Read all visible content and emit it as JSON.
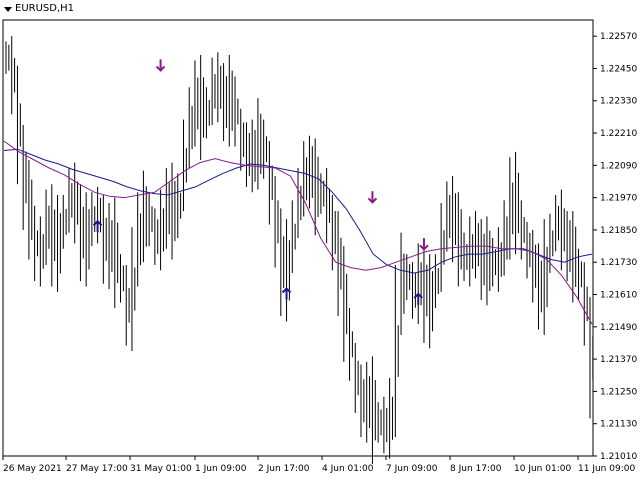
{
  "chart_data": {
    "type": "line",
    "symbol": "EURUSD,H1",
    "title": "EURUSD,H1",
    "ylim": [
      1.2101,
      1.2263
    ],
    "y_ticks": [
      "1.22570",
      "1.22450",
      "1.22330",
      "1.22210",
      "1.22090",
      "1.21970",
      "1.21850",
      "1.21730",
      "1.21610",
      "1.21490",
      "1.21370",
      "1.21250",
      "1.21130",
      "1.21010"
    ],
    "x_ticks": [
      "26 May 2021",
      "27 May 17:00",
      "31 May 01:00",
      "1 Jun 09:00",
      "2 Jun 17:00",
      "4 Jun 01:00",
      "7 Jun 09:00",
      "8 Jun 17:00",
      "10 Jun 01:00",
      "11 Jun 09:00"
    ],
    "price_series": [
      1.2249,
      1.2236,
      1.2212,
      1.2197,
      1.2188,
      1.2172,
      1.2182,
      1.219,
      1.2176,
      1.2184,
      1.2192,
      1.22,
      1.219,
      1.2178,
      1.2185,
      1.2193,
      1.2188,
      1.2175,
      1.2183,
      1.217,
      1.2164,
      1.215,
      1.2176,
      1.2187,
      1.2193,
      1.2185,
      1.218,
      1.219,
      1.2196,
      1.2188,
      1.22,
      1.2218,
      1.2228,
      1.2236,
      1.2225,
      1.2232,
      1.2241,
      1.2235,
      1.223,
      1.2236,
      1.2222,
      1.2215,
      1.2211,
      1.2214,
      1.222,
      1.221,
      1.2195,
      1.2181,
      1.2165,
      1.2175,
      1.219,
      1.22,
      1.2208,
      1.2205,
      1.2197,
      1.22,
      1.2188,
      1.218,
      1.2165,
      1.215,
      1.2135,
      1.2125,
      1.2118,
      1.2124,
      1.2112,
      1.2115,
      1.211,
      1.212,
      1.216,
      1.217,
      1.2165,
      1.216,
      1.217,
      1.2155,
      1.2162,
      1.217,
      1.2187,
      1.2193,
      1.2185,
      1.2178,
      1.2172,
      1.2182,
      1.2177,
      1.2171,
      1.2176,
      1.217,
      1.2178,
      1.2186,
      1.22,
      1.219,
      1.218,
      1.2175,
      1.2168,
      1.216,
      1.2175,
      1.2185,
      1.219,
      1.218,
      1.2178,
      1.2172,
      1.2165,
      1.215,
      1.2125
    ],
    "series": [
      {
        "name": "",
        "color": "#1a1a8c",
        "values": [
          1.22145,
          1.2215,
          1.2213,
          1.2211,
          1.22095,
          1.22075,
          1.2206,
          1.22045,
          1.2203,
          1.2201,
          1.21995,
          1.21985,
          1.2198,
          1.21995,
          1.2201,
          1.22035,
          1.2206,
          1.2208,
          1.22095,
          1.2209,
          1.2208,
          1.2207,
          1.2206,
          1.2204,
          1.2199,
          1.2193,
          1.2185,
          1.2176,
          1.2172,
          1.217,
          1.2169,
          1.217,
          1.2173,
          1.2175,
          1.2176,
          1.2176,
          1.2177,
          1.2178,
          1.2178,
          1.2176,
          1.2174,
          1.2173,
          1.2175,
          1.2176
        ]
      },
      {
        "name": "",
        "color": "#8c1a8c",
        "values": [
          1.2218,
          1.2214,
          1.2211,
          1.2208,
          1.22055,
          1.2202,
          1.2199,
          1.21975,
          1.2197,
          1.2198,
          1.2199,
          1.2203,
          1.2207,
          1.221,
          1.22115,
          1.221,
          1.2209,
          1.22085,
          1.2208,
          1.2205,
          1.2195,
          1.2182,
          1.2173,
          1.2171,
          1.217,
          1.2171,
          1.2173,
          1.2175,
          1.2177,
          1.2178,
          1.21785,
          1.2179,
          1.2179,
          1.2178,
          1.2178,
          1.2177,
          1.2174,
          1.2168,
          1.216,
          1.215
        ]
      }
    ],
    "arrows": [
      {
        "type": "up",
        "x_index": 16,
        "price": 1.2186,
        "color": "#1a1a8c"
      },
      {
        "type": "down",
        "x_index": 27,
        "price": 1.22465,
        "color": "#8c1a8c"
      },
      {
        "type": "up",
        "x_index": 49,
        "price": 1.2161,
        "color": "#1a1a8c"
      },
      {
        "type": "down",
        "x_index": 64,
        "price": 1.21975,
        "color": "#8c1a8c"
      },
      {
        "type": "up",
        "x_index": 72,
        "price": 1.2159,
        "color": "#1a1a8c"
      },
      {
        "type": "down",
        "x_index": 73,
        "price": 1.218,
        "color": "#8c1a8c"
      }
    ],
    "grid": false
  }
}
